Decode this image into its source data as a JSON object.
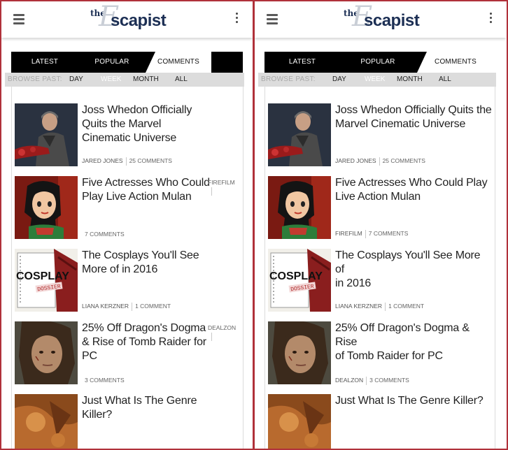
{
  "header": {
    "logo_the": "the",
    "logo_e": "E",
    "logo_word": "scapist"
  },
  "tabs": {
    "latest": "LATEST",
    "popular": "POPULAR",
    "comments": "COMMENTS"
  },
  "browse": {
    "label": "BROWSE PAST:",
    "day": "DAY",
    "week": "WEEK",
    "month": "MONTH",
    "all": "ALL"
  },
  "articles": [
    {
      "title_left": [
        "Joss Whedon Officially",
        "Quits the Marvel",
        "Cinematic Universe"
      ],
      "title_right": [
        "Joss Whedon Officially Quits the",
        "Marvel Cinematic Universe"
      ],
      "author": "JARED JONES",
      "comments": "25 COMMENTS"
    },
    {
      "title_left": [
        "Five Actresses Who Could",
        "Play Live Action Mulan"
      ],
      "title_right": [
        "Five Actresses Who Could Play",
        "Live Action Mulan"
      ],
      "author": "FIREFILM",
      "comments": "7 COMMENTS"
    },
    {
      "title_left": [
        "The Cosplays You'll See",
        "More of in 2016"
      ],
      "title_right": [
        "The Cosplays You'll See More of",
        "in 2016"
      ],
      "author": "LIANA KERZNER",
      "comments": "1 COMMENT",
      "thumb_text_1": "COSPLAY",
      "thumb_text_2": "DOSSIER"
    },
    {
      "title_left": [
        "25% Off Dragon's Dogma",
        "& Rise of Tomb Raider for",
        "PC"
      ],
      "title_right": [
        "25% Off Dragon's Dogma & Rise",
        "of Tomb Raider for PC"
      ],
      "author": "DEALZON",
      "comments": "3 COMMENTS"
    },
    {
      "title_left": [
        "Just What Is The Genre",
        "Killer?"
      ],
      "title_right": [
        "Just What Is The Genre Killer?"
      ]
    }
  ]
}
